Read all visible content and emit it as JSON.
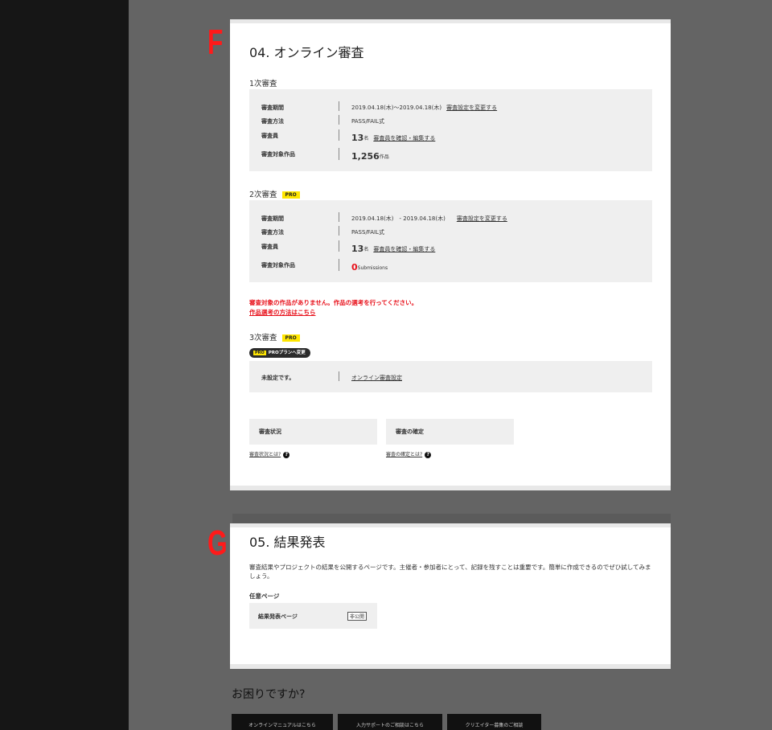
{
  "markers": {
    "f": "F",
    "g": "G"
  },
  "section_04": {
    "title": "04. オンライン審査",
    "stage1": {
      "heading": "1次審査",
      "rows": {
        "period": {
          "label": "審査期間",
          "value": "2019.04.18(木)〜2019.04.18(木)",
          "link": "審査設定を変更する"
        },
        "method": {
          "label": "審査方法",
          "value": "PASS/FAIL式"
        },
        "judges": {
          "label": "審査員",
          "count": "13",
          "unit": "名",
          "link": "審査員を確認・編集する"
        },
        "works": {
          "label": "審査対象作品",
          "count": "1,256",
          "unit": "作品"
        }
      }
    },
    "stage2": {
      "heading": "2次審査",
      "pro_badge": "PRO",
      "rows": {
        "period": {
          "label": "審査期間",
          "value": "2019.04.18(木)　- 2019.04.18(木)",
          "link": "審査設定を変更する"
        },
        "method": {
          "label": "審査方法",
          "value": "PASS/FAIL式"
        },
        "judges": {
          "label": "審査員",
          "count": "13",
          "unit": "名",
          "link": "審査員を確認・編集する"
        },
        "works": {
          "label": "審査対象作品",
          "count": "0",
          "unit": "Submissions"
        }
      },
      "error_text": "審査対象の作品がありません。作品の選考を行ってください。",
      "error_link": "作品選考の方法はこちら"
    },
    "stage3": {
      "heading": "3次審査",
      "pro_badge": "PRO",
      "upgrade_tag": "PRO",
      "upgrade_label": "PROプランへ変更",
      "status": "未設定です。",
      "link": "オンライン審査設定"
    },
    "status_box": {
      "label": "審査状況",
      "help": "審査状況とは?"
    },
    "confirm_box": {
      "label": "審査の確定",
      "help": "審査の確定とは?"
    },
    "help_icon": "?"
  },
  "section_05": {
    "title": "05. 結果発表",
    "description": "審査結果やプロジェクトの結果を公開するページです。主催者・参加者にとって、記録を残すことは重要です。簡単に作成できるのでぜひ試してみましょう。",
    "optional_label": "任意ページ",
    "page": {
      "label": "結果発表ページ",
      "badge": "非公開"
    }
  },
  "footer": {
    "help_title": "お困りですか?",
    "buttons": [
      "オンラインマニュアルはこちら",
      "入力サポートのご相談はこちら",
      "クリエイター募集のご相談"
    ]
  },
  "colors": {
    "accent_red": "#e8111b",
    "pro_yellow": "#ffe600",
    "marker_red": "#ff1a1a"
  }
}
